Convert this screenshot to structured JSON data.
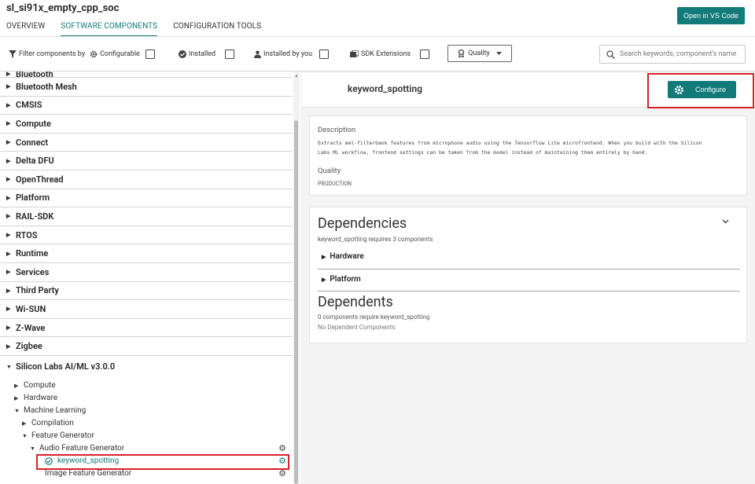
{
  "app": {
    "title": "sl_si91x_empty_cpp_soc"
  },
  "header": {
    "open_vs_code_label": "Open in VS Code",
    "tabs": [
      {
        "label": "OVERVIEW",
        "active": false
      },
      {
        "label": "SOFTWARE COMPONENTS",
        "active": true
      },
      {
        "label": "CONFIGURATION TOOLS",
        "active": false
      }
    ]
  },
  "filters": {
    "filter_label": "Filter components by",
    "configurable_label": "Configurable",
    "installed_label": "Installed",
    "installed_by_you_label": "Installed by you",
    "sdk_extensions_label": "SDK Extensions",
    "quality_label": "Quality",
    "search_placeholder": "Search keywords, component's name"
  },
  "tree": {
    "partial_top": "Bluetooth",
    "categories": [
      "Bluetooth Mesh",
      "CMSIS",
      "Compute",
      "Connect",
      "Delta DFU",
      "OpenThread",
      "Platform",
      "RAIL-SDK",
      "RTOS",
      "Runtime",
      "Services",
      "Third Party",
      "Wi-SUN",
      "Z-Wave",
      "Zigbee"
    ],
    "expanded_category": "Silicon Labs AI/ML v3.0.0",
    "sub": {
      "compute": "Compute",
      "hardware": "Hardware",
      "machine_learning": "Machine Learning",
      "compilation": "Compilation",
      "feature_generator": "Feature Generator",
      "audio_feature_generator": "Audio Feature Generator",
      "keyword_spotting": "keyword_spotting",
      "image_feature_generator": "Image Feature Generator"
    }
  },
  "component": {
    "title": "keyword_spotting",
    "configure_label": "Configure",
    "description_heading": "Description",
    "description_line1": "Extracts mel-filterbank features from microphone audio using the Tensorflow Lite microfrontend. When you build with the Silicon",
    "description_line2": "Labs ML workflow, frontend settings can be taken from the model instead of maintaining them entirely by hand.",
    "quality_heading": "Quality",
    "quality_value": "PRODUCTION",
    "dependencies_heading": "Dependencies",
    "dependencies_summary": "keyword_spotting requires 3 components",
    "dependency_groups": [
      "Hardware",
      "Platform"
    ],
    "dependents_heading": "Dependents",
    "dependents_summary": "0 components require keyword_spotting",
    "dependents_empty": "No Dependent Components"
  },
  "colors": {
    "accent": "#137a7a",
    "highlight": "#d9202a"
  },
  "icons": [
    "filter-icon",
    "gear-icon",
    "check-circle-icon",
    "person-icon",
    "sdk-extension-icon",
    "ribbon-icon",
    "caret-down-icon",
    "search-icon",
    "chevron-down-icon",
    "triangle-right-icon",
    "triangle-down-icon"
  ]
}
